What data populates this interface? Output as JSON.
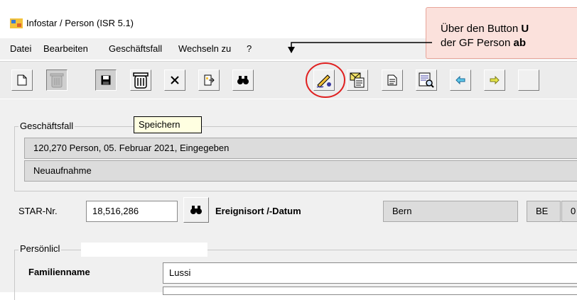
{
  "window": {
    "title": "Infostar / Person (ISR 5.1)"
  },
  "menu": {
    "datei_label": "Datei",
    "bearbeiten_label": "Bearbeiten",
    "geschaeftsfall_label": "Geschäftsfall",
    "wechseln_label": "Wechseln zu",
    "help_label": "?"
  },
  "callout": {
    "line1_prefix": "Über den Button ",
    "line1_bold": "U",
    "line2_prefix": "der GF Person ",
    "line2_bold": "ab"
  },
  "tooltip": {
    "text": "Speichern"
  },
  "toolbar": {
    "icons": [
      "new-document-icon",
      "trash-disabled-icon",
      "save-icon",
      "trash-icon",
      "delete-x-icon",
      "exit-door-icon",
      "binoculars-search-icon",
      "sign-pen-icon",
      "envelope-document-icon",
      "document-icon",
      "list-search-icon",
      "arrow-left-icon",
      "arrow-right-icon"
    ]
  },
  "geschaeftsfall": {
    "label": "Geschäftsfall",
    "line1": "120,270  Person, 05. Februar 2021, Eingegeben",
    "line2": "Neuaufnahme"
  },
  "star": {
    "label": "STAR-Nr.",
    "value": "18,516,286",
    "ereignis_label": "Ereignisort /-Datum",
    "ort_value": "Bern",
    "kanton_value": "BE",
    "datum_value": "0"
  },
  "persoenlich": {
    "label": "Persönlicl",
    "familienname_label": "Familienname",
    "familienname_value": "Lussi"
  },
  "colors": {
    "highlight_circle": "#e02020",
    "callout_bg": "#fbe1dc"
  }
}
